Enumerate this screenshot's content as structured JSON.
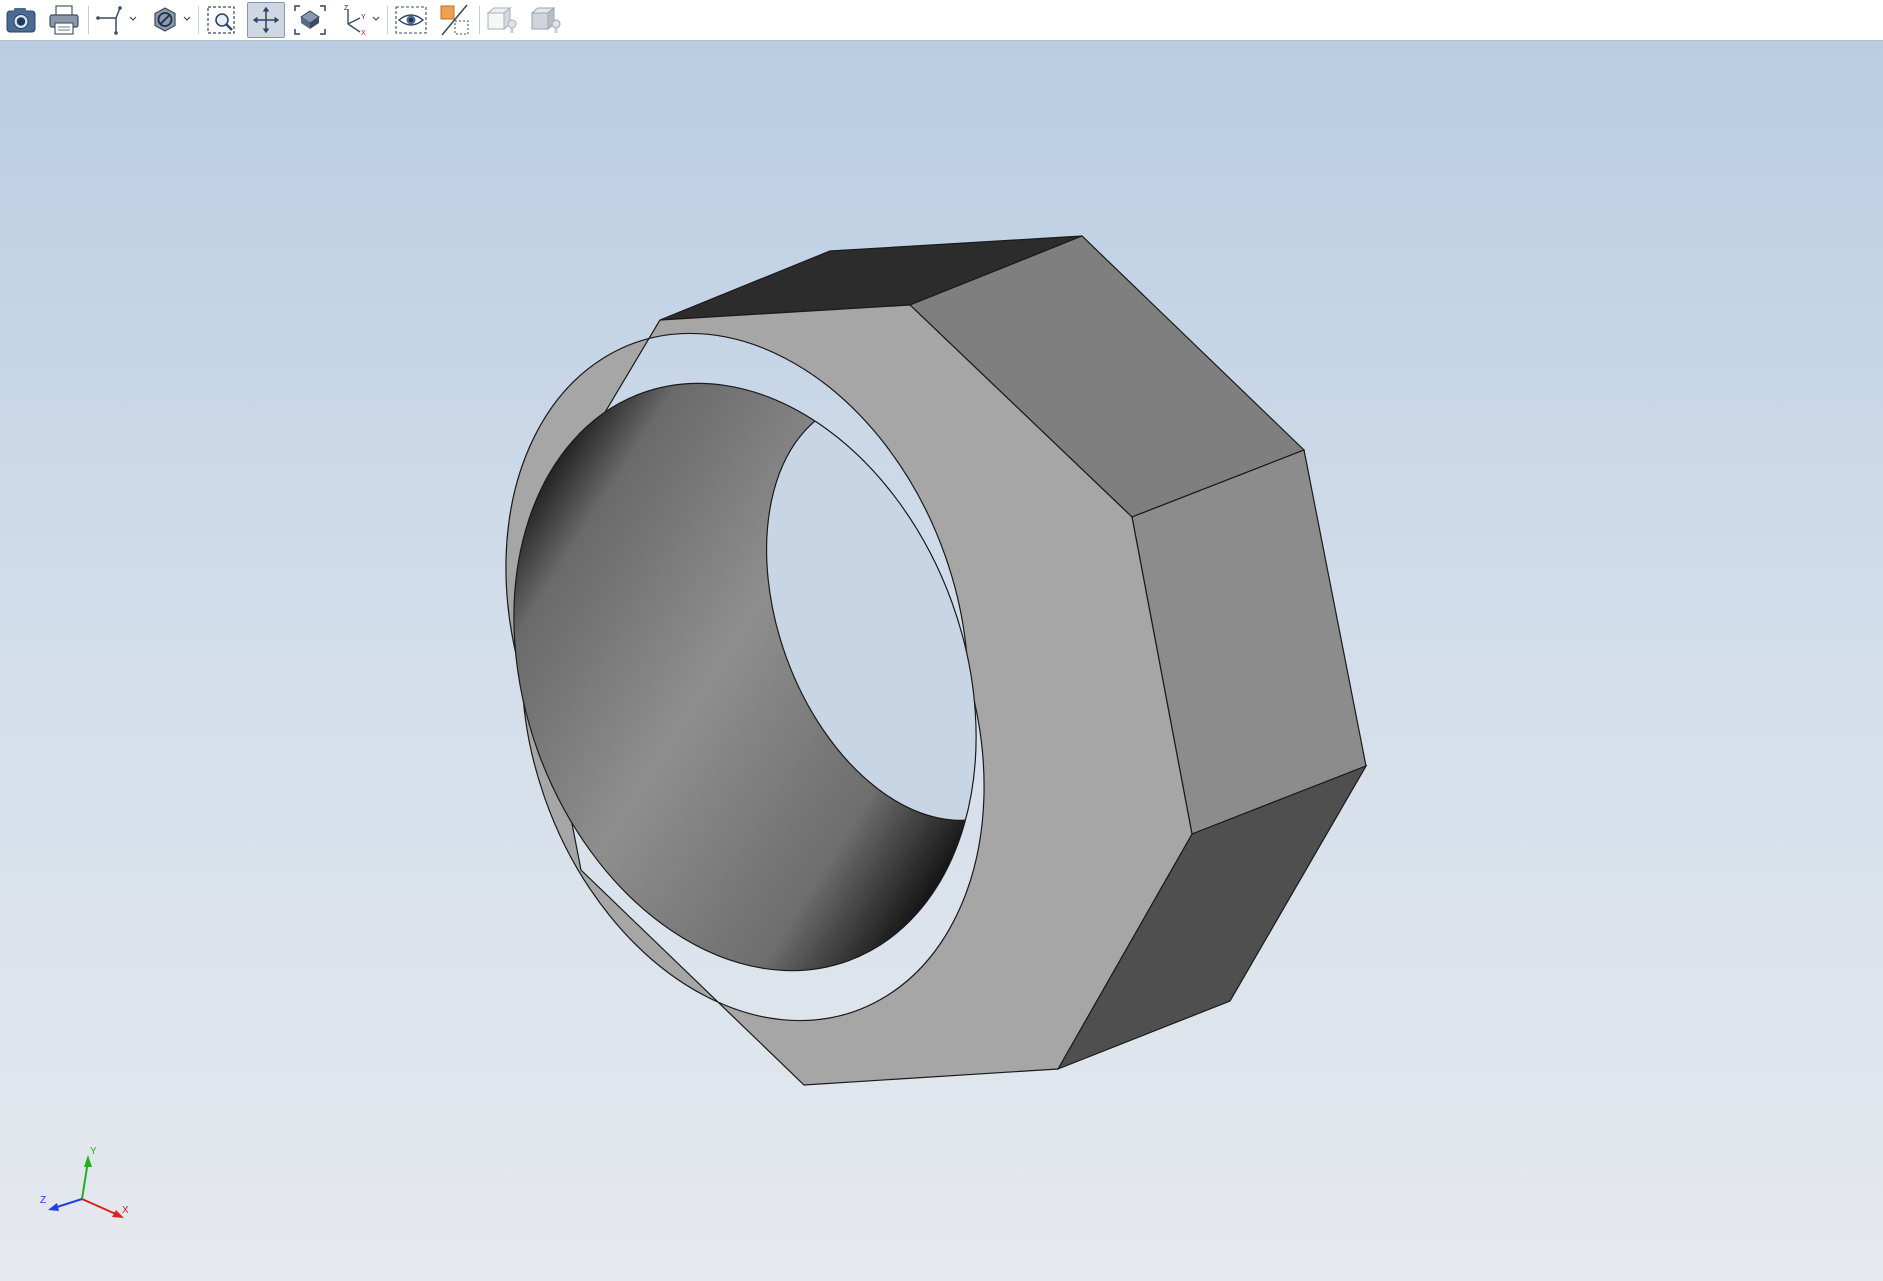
{
  "toolbar": {
    "buttons": [
      {
        "name": "camera-snapshot-button",
        "icon": "camera-icon"
      },
      {
        "name": "print-button",
        "icon": "printer-icon"
      },
      {
        "name": "projection-dropdown-button",
        "icon": "projection-axes-icon",
        "has_dropdown": true
      },
      {
        "name": "display-mode-dropdown-button",
        "icon": "prohibited-circle-icon",
        "has_dropdown": true
      },
      {
        "name": "zoom-window-button",
        "icon": "zoom-window-icon"
      },
      {
        "name": "pan-button",
        "icon": "pan-arrows-icon",
        "pressed": true
      },
      {
        "name": "zoom-fit-button",
        "icon": "zoom-fit-icon"
      },
      {
        "name": "view-orientation-dropdown-button",
        "icon": "xyz-axes-icon",
        "has_dropdown": true
      },
      {
        "name": "visibility-button",
        "icon": "eye-icon"
      },
      {
        "name": "section-view-button",
        "icon": "section-plane-icon"
      },
      {
        "name": "light-1-button",
        "icon": "box-light-icon",
        "disabled": true
      },
      {
        "name": "light-2-button",
        "icon": "box-light-icon",
        "disabled": true
      }
    ]
  },
  "viewport": {
    "background_top": "#bacde3",
    "background_bottom": "#e6e9ee",
    "model": {
      "type": "octagonal-nut",
      "front_face_color": "#a6a6a6",
      "side_face_colors": [
        "#7f7f7f",
        "#8c8c8c",
        "#4f4f4f",
        "#2c2c2c"
      ],
      "edge_color": "#1a1a1a"
    },
    "triad": {
      "x_label": "X",
      "y_label": "Y",
      "z_label": "Z",
      "x_color": "#e02020",
      "y_color": "#20b020",
      "z_color": "#2040e0"
    }
  }
}
